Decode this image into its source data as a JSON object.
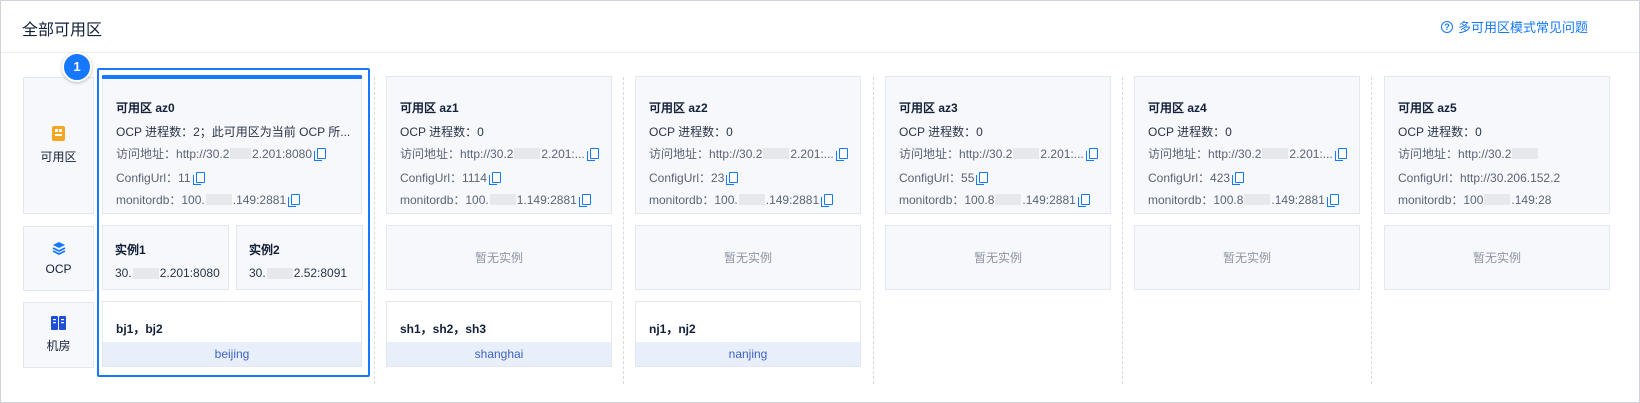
{
  "header": {
    "title": "全部可用区",
    "help_label": "多可用区模式常见问题",
    "help_icon": "question-circle-icon"
  },
  "row_headers": [
    {
      "label": "可用区",
      "icon": "zone-icon"
    },
    {
      "label": "OCP",
      "icon": "layers-icon"
    },
    {
      "label": "机房",
      "icon": "datacenter-icon"
    }
  ],
  "badge": {
    "number": "1"
  },
  "colors": {
    "accent": "#1677ff",
    "region_bg": "#e9eefb",
    "card_bg": "#f6f8fb"
  },
  "zones": [
    {
      "name": "可用区 az0",
      "ocp_count": "OCP 进程数：2；此可用区为当前 OCP 所...",
      "access_prefix": "访问地址：",
      "access_a": "http://30.2",
      "access_b": "2.201:8080",
      "config_prefix": "ConfigUrl：",
      "config_value": "11",
      "monitor_prefix": "monitordb：",
      "monitor_a": "100.",
      "monitor_b": ".149:2881",
      "instances": [
        {
          "name": "实例1",
          "addr_a": "30.",
          "addr_b": "2.201:8080"
        },
        {
          "name": "实例2",
          "addr_a": "30.",
          "addr_b": "2.52:8091"
        }
      ],
      "idcs": "bj1，bj2",
      "region": "beijing"
    },
    {
      "name": "可用区 az1",
      "ocp_count": "OCP 进程数：0",
      "access_prefix": "访问地址：",
      "access_a": "http://30.2",
      "access_b": "2.201:...",
      "config_prefix": "ConfigUrl：",
      "config_value": "1114",
      "monitor_prefix": "monitordb：",
      "monitor_a": "100.",
      "monitor_b": "1.149:2881",
      "empty_label": "暂无实例",
      "idcs": "sh1，sh2，sh3",
      "region": "shanghai"
    },
    {
      "name": "可用区 az2",
      "ocp_count": "OCP 进程数：0",
      "access_prefix": "访问地址：",
      "access_a": "http://30.2",
      "access_b": "2.201:...",
      "config_prefix": "ConfigUrl：",
      "config_value": "23",
      "monitor_prefix": "monitordb：",
      "monitor_a": "100.",
      "monitor_b": ".149:2881",
      "empty_label": "暂无实例",
      "idcs": "nj1，nj2",
      "region": "nanjing"
    },
    {
      "name": "可用区 az3",
      "ocp_count": "OCP 进程数：0",
      "access_prefix": "访问地址：",
      "access_a": "http://30.2",
      "access_b": "2.201:...",
      "config_prefix": "ConfigUrl：",
      "config_value": "55",
      "monitor_prefix": "monitordb：",
      "monitor_a": "100.8",
      "monitor_b": ".149:2881",
      "empty_label": "暂无实例"
    },
    {
      "name": "可用区 az4",
      "ocp_count": "OCP 进程数：0",
      "access_prefix": "访问地址：",
      "access_a": "http://30.2",
      "access_b": "2.201:...",
      "config_prefix": "ConfigUrl：",
      "config_value": "423",
      "monitor_prefix": "monitordb：",
      "monitor_a": "100.8",
      "monitor_b": ".149:2881",
      "empty_label": "暂无实例"
    },
    {
      "name": "可用区 az5",
      "ocp_count": "OCP 进程数：0",
      "access_prefix": "访问地址：",
      "access_a": "http://30.2",
      "access_b": "",
      "config_prefix": "ConfigUrl：",
      "config_value": "http://30.206.152.2",
      "monitor_prefix": "monitordb：",
      "monitor_a": "100",
      "monitor_b": ".149:28",
      "empty_label": "暂无实例"
    }
  ]
}
